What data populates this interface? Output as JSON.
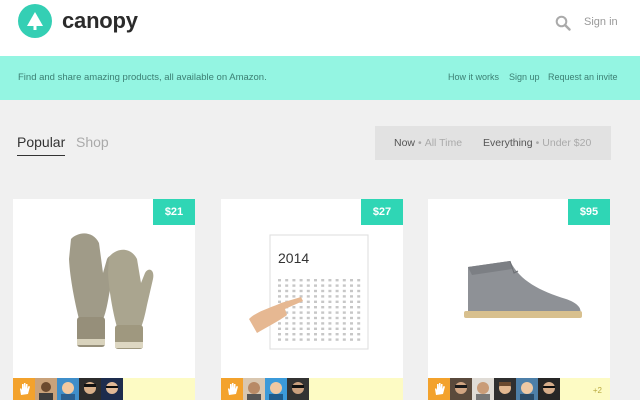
{
  "brand": {
    "name": "canopy"
  },
  "header": {
    "signin_label": "Sign in"
  },
  "banner": {
    "tagline": "Find and share amazing products, all available on Amazon.",
    "links": [
      "How it works",
      "Sign up",
      "Request an invite"
    ]
  },
  "tabs": [
    "Popular",
    "Shop"
  ],
  "filters": {
    "time": {
      "active": "Now",
      "inactive": "All Time"
    },
    "price": {
      "active": "Everything",
      "inactive": "Under $20"
    }
  },
  "products": [
    {
      "price": "$21",
      "image": "mittens-image"
    },
    {
      "price": "$27",
      "image": "calendar-image",
      "calendar_year": "2014"
    },
    {
      "price": "$95",
      "image": "chukka-boot-image",
      "extra_count": "+2"
    }
  ],
  "colors": {
    "accent": "#2fd6b5",
    "banner": "#94f5e2",
    "footer": "#fdfbc4",
    "hand": "#f3a22c"
  }
}
